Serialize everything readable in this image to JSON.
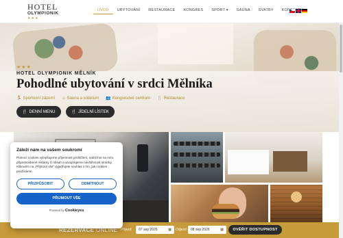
{
  "header": {
    "logo_top": "HOTEL",
    "logo_bottom": "OLYMPIONIK",
    "logo_stars": "★★★",
    "nav": [
      {
        "label": "ÚVOD",
        "active": true
      },
      {
        "label": "UBYTOVÁNÍ"
      },
      {
        "label": "RESTAURACE"
      },
      {
        "label": "KONGRES"
      },
      {
        "label": "SPORT ▾"
      },
      {
        "label": "SAUNA"
      },
      {
        "label": "SVATBY"
      },
      {
        "label": "KONTAKTY"
      }
    ],
    "flags": [
      "flag-cz-icon",
      "flag-en-icon",
      "flag-de-icon"
    ]
  },
  "hero": {
    "stars": "★★★",
    "subtitle": "HOTEL OLYMPIONIK MĚLNÍK",
    "title": "Pohodlné ubytování v srdci Mělníka",
    "features": [
      {
        "icon": "🏃",
        "label": "Sportovní zázemí"
      },
      {
        "icon": "♨",
        "label": "Sauna a solárium"
      },
      {
        "icon": "👥",
        "label": "Kongresové centrum"
      },
      {
        "icon": "🍴",
        "label": "Restaurace"
      }
    ],
    "buttons": [
      {
        "icon": "🍴",
        "label": "DENNÍ MENU"
      },
      {
        "icon": "🍴",
        "label": "JÍDELNÍ LÍSTEK"
      }
    ]
  },
  "cookie": {
    "title": "Záleží nám na vašem soukromí",
    "text": "Pomocí cookies vylepšujeme přijemnost prohlížení, nabízíme na míru připsobosbené reklamy či obsah a analyzujeme návštěvnost stránky. Kliknutím na „Přijmout vše\" vyjadřujete souhlas s tím, jak cookies používáme.",
    "customize_label": "PŘIZPŮSOBIT",
    "reject_label": "ODMÍTNOUT",
    "accept_label": "PŘIJMOUT VŠE",
    "powered_by": "Powered by",
    "brand": "Cookieyes"
  },
  "booking": {
    "label_bold": "REZERVACE",
    "label_light": "ONLINE",
    "arrival_label": "Příjezd",
    "arrival_value": "07 sep 2026",
    "departure_label": "Odjezd",
    "departure_value": "08 sep 2026",
    "calendar_icon": "calendar-icon",
    "button_label": "OVĚŘIT DOSTUPNOST"
  },
  "colors": {
    "accent": "#c79a3a",
    "dark": "#2b2b2b",
    "cookie_blue": "#1563c8"
  }
}
